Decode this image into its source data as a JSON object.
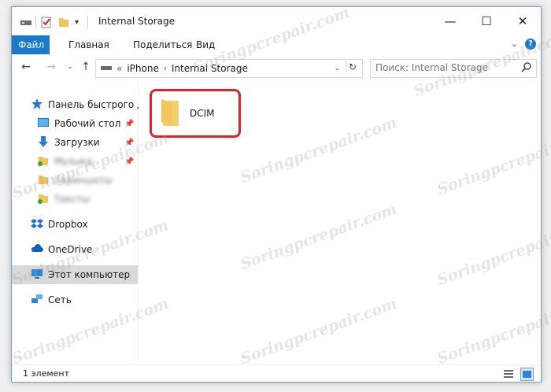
{
  "window": {
    "title": "Internal Storage"
  },
  "ribbon": {
    "tabs": [
      "Файл",
      "Главная",
      "Поделиться",
      "Вид"
    ]
  },
  "address": {
    "prefix": "«",
    "crumbs": [
      "iPhone",
      "Internal Storage"
    ]
  },
  "search": {
    "placeholder": "Поиск: Internal Storage"
  },
  "nav": {
    "quick_access": "Панель быстрого дс",
    "desktop": "Рабочий стол",
    "downloads": "Загрузки",
    "blurred_items": [
      "Музыка",
      "Скриншоты",
      "Тексты"
    ],
    "dropbox": "Dropbox",
    "onedrive": "OneDrive",
    "this_pc": "Этот компьютер",
    "network": "Сеть"
  },
  "content": {
    "folder_name": "DCIM"
  },
  "status": {
    "count_text": "1 элемент"
  },
  "watermark": {
    "text": "Soringpcrepair.com"
  },
  "colors": {
    "accent": "#1979ca",
    "highlight": "#d9262b",
    "folder": "#f2c55c"
  }
}
